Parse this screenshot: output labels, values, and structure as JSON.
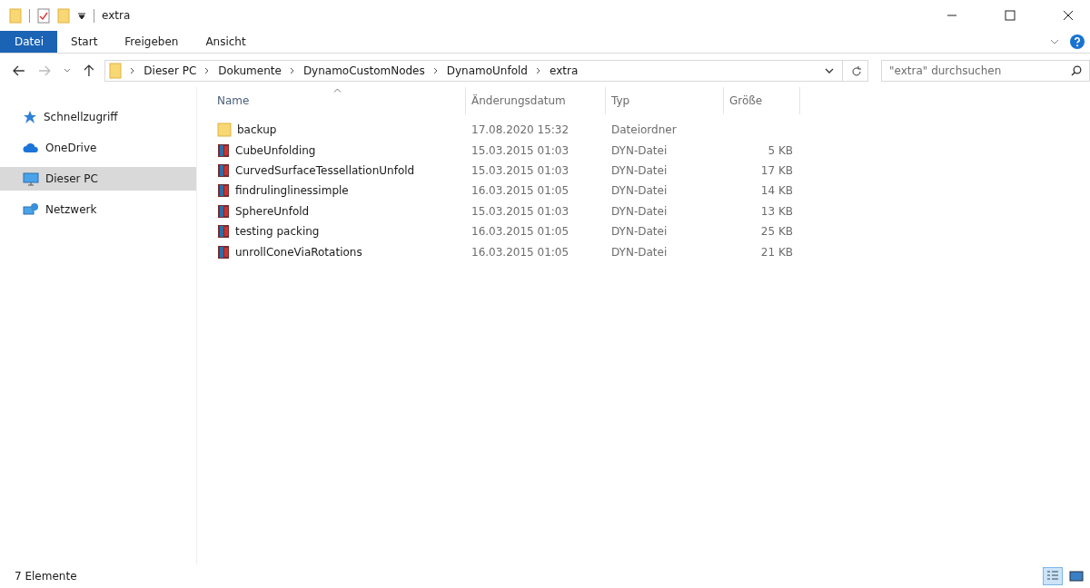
{
  "window": {
    "title": "extra"
  },
  "ribbon_tabs": [
    {
      "label": "Datei",
      "kind": "file"
    },
    {
      "label": "Start",
      "kind": "tab"
    },
    {
      "label": "Freigeben",
      "kind": "tab"
    },
    {
      "label": "Ansicht",
      "kind": "tab"
    }
  ],
  "breadcrumb": [
    "Dieser PC",
    "Dokumente",
    "DynamoCustomNodes",
    "DynamoUnfold",
    "extra"
  ],
  "search": {
    "placeholder": "\"extra\" durchsuchen"
  },
  "sidebar": {
    "items": [
      {
        "label": "Schnellzugriff",
        "kind": "star",
        "selected": false
      },
      {
        "label": "OneDrive",
        "kind": "cloud",
        "selected": false
      },
      {
        "label": "Dieser PC",
        "kind": "pc",
        "selected": true
      },
      {
        "label": "Netzwerk",
        "kind": "network",
        "selected": false
      }
    ]
  },
  "table": {
    "columns": [
      "Name",
      "Änderungsdatum",
      "Typ",
      "Größe"
    ],
    "rows": [
      {
        "kind": "folder",
        "name": "backup",
        "date": "17.08.2020 15:32",
        "type": "Dateiordner",
        "size": ""
      },
      {
        "kind": "file",
        "name": "CubeUnfolding",
        "date": "15.03.2015 01:03",
        "type": "DYN-Datei",
        "size": "5 KB"
      },
      {
        "kind": "file",
        "name": "CurvedSurfaceTessellationUnfold",
        "date": "15.03.2015 01:03",
        "type": "DYN-Datei",
        "size": "17 KB"
      },
      {
        "kind": "file",
        "name": "findrulinglinessimple",
        "date": "16.03.2015 01:05",
        "type": "DYN-Datei",
        "size": "14 KB"
      },
      {
        "kind": "file",
        "name": "SphereUnfold",
        "date": "15.03.2015 01:03",
        "type": "DYN-Datei",
        "size": "13 KB"
      },
      {
        "kind": "file",
        "name": "testing packing",
        "date": "16.03.2015 01:05",
        "type": "DYN-Datei",
        "size": "25 KB"
      },
      {
        "kind": "file",
        "name": "unrollConeViaRotations",
        "date": "16.03.2015 01:05",
        "type": "DYN-Datei",
        "size": "21 KB"
      }
    ]
  },
  "status_bar": {
    "count": "7 Elemente",
    "views": [
      {
        "kind": "details",
        "selected": true
      },
      {
        "kind": "tiles",
        "selected": false
      }
    ]
  }
}
